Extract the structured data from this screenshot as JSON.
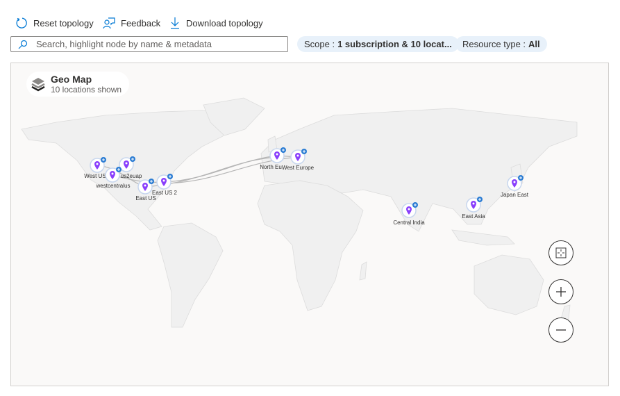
{
  "toolbar": {
    "reset": "Reset topology",
    "feedback": "Feedback",
    "download": "Download topology"
  },
  "search": {
    "placeholder": "Search, highlight node by name & metadata",
    "value": ""
  },
  "filters": {
    "scope_label": "Scope :",
    "scope_value": "1 subscription & 10 locat...",
    "resource_label": "Resource type :",
    "resource_value": "All"
  },
  "legend": {
    "title": "Geo Map",
    "subtitle": "10 locations shown"
  },
  "colors": {
    "accent": "#0078d4",
    "pin": "#8a3ffc",
    "badge": "#2b7cd3"
  },
  "locations": [
    {
      "name": "West US",
      "icon": "map-pin-icon"
    },
    {
      "name": "us2euap",
      "icon": "map-pin-icon"
    },
    {
      "name": "westcentralus",
      "icon": "map-pin-icon"
    },
    {
      "name": "East US",
      "icon": "map-pin-icon"
    },
    {
      "name": "East US 2",
      "icon": "map-pin-icon"
    },
    {
      "name": "North Eu",
      "icon": "map-pin-icon"
    },
    {
      "name": "West Europe",
      "icon": "map-pin-icon"
    },
    {
      "name": "Central India",
      "icon": "map-pin-icon"
    },
    {
      "name": "East Asia",
      "icon": "map-pin-icon"
    },
    {
      "name": "Japan East",
      "icon": "map-pin-icon"
    }
  ],
  "controls": [
    "fit-to-screen",
    "zoom-in",
    "zoom-out"
  ]
}
